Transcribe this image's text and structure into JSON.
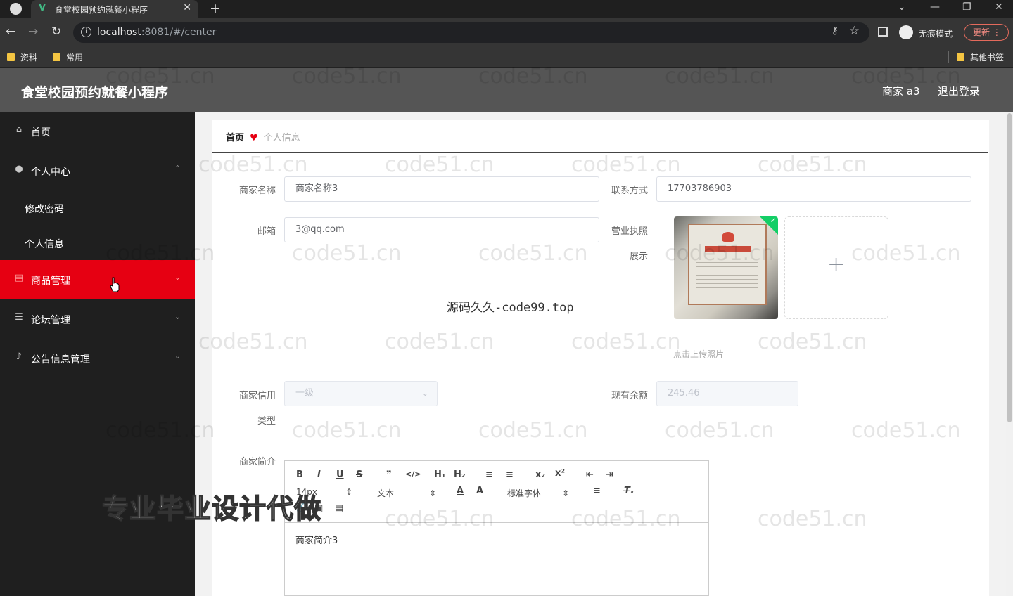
{
  "browser": {
    "tab_title": "食堂校园预约就餐小程序",
    "url_host": "localhost",
    "url_rest": ":8081/#/center",
    "incognito_label": "无痕模式",
    "update_label": "更新",
    "bookmarks": [
      "资料",
      "常用"
    ],
    "other_bookmarks": "其他书签"
  },
  "header": {
    "title": "食堂校园预约就餐小程序",
    "user": "商家 a3",
    "logout": "退出登录"
  },
  "sidebar": {
    "items": [
      {
        "label": "首页",
        "icon": "home-icon"
      },
      {
        "label": "个人中心",
        "icon": "user-icon"
      },
      {
        "label": "修改密码"
      },
      {
        "label": "个人信息"
      },
      {
        "label": "商品管理",
        "icon": "chat-icon"
      },
      {
        "label": "论坛管理",
        "icon": "list-icon"
      },
      {
        "label": "公告信息管理",
        "icon": "mic-icon"
      }
    ],
    "active_color": "#e60012"
  },
  "breadcrumb": {
    "home": "首页",
    "current": "个人信息"
  },
  "form": {
    "shop_name_label": "商家名称",
    "shop_name_value": "商家名称3",
    "contact_label": "联系方式",
    "contact_value": "17703786903",
    "email_label": "邮箱",
    "email_value": "3@qq.com",
    "license_label_1": "营业执照",
    "license_label_2": "展示",
    "upload_hint": "点击上传照片",
    "credit_label_1": "商家信用",
    "credit_label_2": "类型",
    "credit_value": "一级",
    "balance_label": "现有余额",
    "balance_value": "245.46",
    "intro_label": "商家简介",
    "intro_value": "商家简介3"
  },
  "editor": {
    "font_size": "14px",
    "format": "文本",
    "font_family": "标准字体"
  },
  "watermarks": {
    "site": "code51.cn",
    "center": "源码久久-code99.top",
    "bottom": "专业毕业设计代做"
  }
}
